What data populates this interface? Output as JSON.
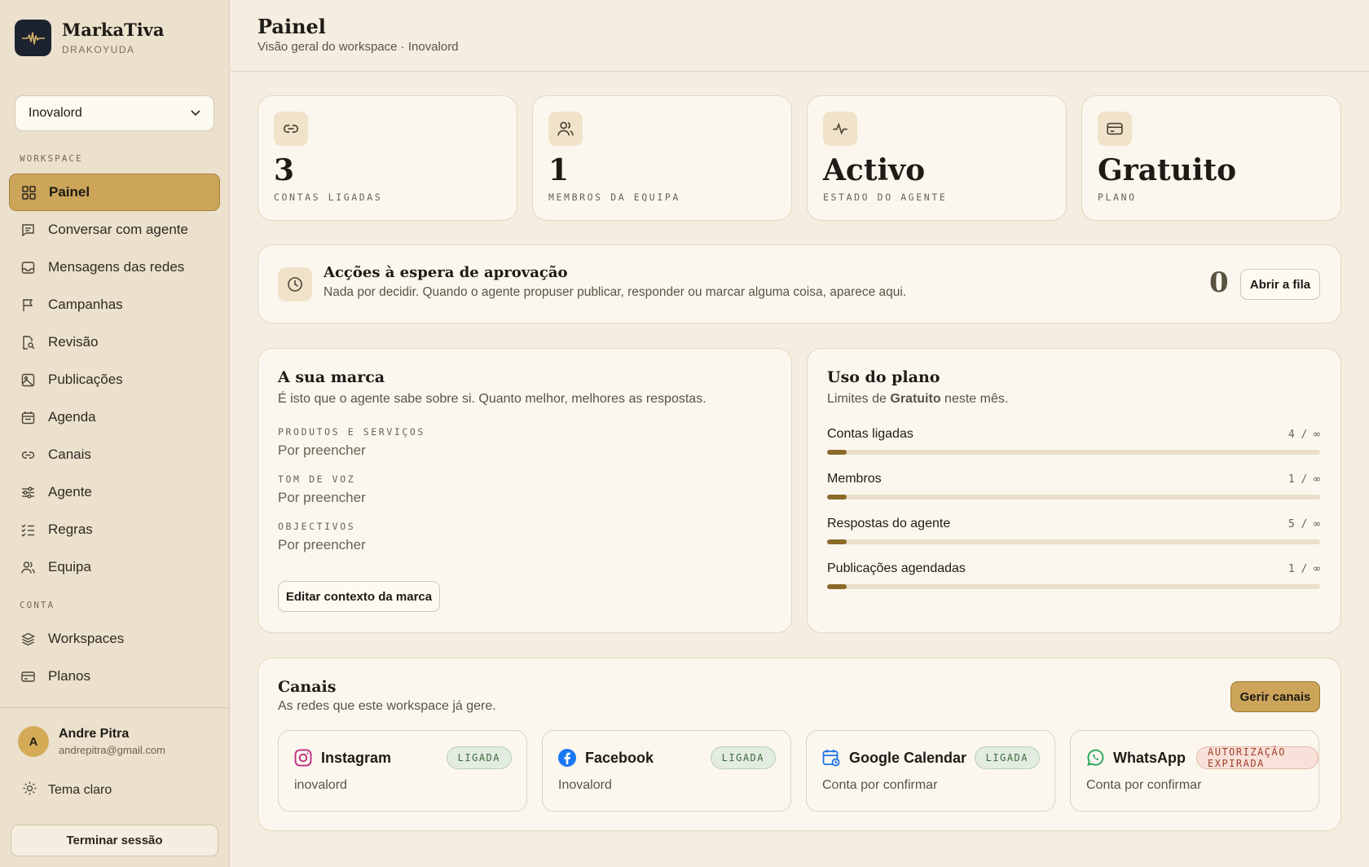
{
  "app": {
    "name": "MarkaTiva",
    "subtitle": "DRAKOYUDA"
  },
  "workspace_select": {
    "value": "Inovalord"
  },
  "sidebar": {
    "section_workspace": "WORKSPACE",
    "section_account": "CONTA",
    "items": [
      {
        "label": "Painel",
        "icon": "dashboard-icon",
        "active": true
      },
      {
        "label": "Conversar com agente",
        "icon": "chat-icon"
      },
      {
        "label": "Mensagens das redes",
        "icon": "inbox-icon"
      },
      {
        "label": "Campanhas",
        "icon": "flag-icon"
      },
      {
        "label": "Revisão",
        "icon": "review-icon"
      },
      {
        "label": "Publicações",
        "icon": "image-icon"
      },
      {
        "label": "Agenda",
        "icon": "calendar-icon"
      },
      {
        "label": "Canais",
        "icon": "link-icon"
      },
      {
        "label": "Agente",
        "icon": "sliders-icon"
      },
      {
        "label": "Regras",
        "icon": "list-check-icon"
      },
      {
        "label": "Equipa",
        "icon": "users-icon"
      }
    ],
    "account_items": [
      {
        "label": "Workspaces",
        "icon": "layers-icon"
      },
      {
        "label": "Planos",
        "icon": "credit-card-icon"
      }
    ],
    "user": {
      "initial": "A",
      "name": "Andre Pitra",
      "email": "andrepitra@gmail.com"
    },
    "theme_label": "Tema claro",
    "logout_label": "Terminar sessão"
  },
  "header": {
    "title": "Painel",
    "subtitle": "Visão geral do workspace · Inovalord"
  },
  "stats": [
    {
      "value": "3",
      "label": "CONTAS LIGADAS",
      "icon": "link-icon"
    },
    {
      "value": "1",
      "label": "MEMBROS DA EQUIPA",
      "icon": "users-icon"
    },
    {
      "value": "Activo",
      "label": "ESTADO DO AGENTE",
      "icon": "activity-icon"
    },
    {
      "value": "Gratuito",
      "label": "PLANO",
      "icon": "credit-card-icon"
    }
  ],
  "pending": {
    "title": "Acções à espera de aprovação",
    "description": "Nada por decidir. Quando o agente propuser publicar, responder ou marcar alguma coisa, aparece aqui.",
    "count": "0",
    "button": "Abrir a fila"
  },
  "brand": {
    "title": "A sua marca",
    "subtitle": "É isto que o agente sabe sobre si. Quanto melhor, melhores as respostas.",
    "fields": [
      {
        "label": "PRODUTOS E SERVIÇOS",
        "value": "Por preencher"
      },
      {
        "label": "TOM DE VOZ",
        "value": "Por preencher"
      },
      {
        "label": "OBJECTIVOS",
        "value": "Por preencher"
      }
    ],
    "button": "Editar contexto da marca"
  },
  "usage": {
    "title": "Uso do plano",
    "subtitle_prefix": "Limites de ",
    "subtitle_plan": "Gratuito",
    "subtitle_suffix": " neste mês.",
    "rows": [
      {
        "name": "Contas ligadas",
        "value": "4 / ∞",
        "fill": 0.04
      },
      {
        "name": "Membros",
        "value": "1 / ∞",
        "fill": 0.04
      },
      {
        "name": "Respostas do agente",
        "value": "5 / ∞",
        "fill": 0.04
      },
      {
        "name": "Publicações agendadas",
        "value": "1 / ∞",
        "fill": 0.04
      }
    ]
  },
  "channels": {
    "title": "Canais",
    "subtitle": "As redes que este workspace já gere.",
    "button": "Gerir canais",
    "items": [
      {
        "name": "Instagram",
        "account": "inovalord",
        "status": "LIGADA",
        "icon": "instagram-icon",
        "color": "#c13584"
      },
      {
        "name": "Facebook",
        "account": "Inovalord",
        "status": "LIGADA",
        "icon": "facebook-icon",
        "color": "#1877f2"
      },
      {
        "name": "Google Calendar",
        "account": "Conta por confirmar",
        "status": "LIGADA",
        "icon": "google-calendar-icon",
        "color": "#1a73e8"
      },
      {
        "name": "WhatsApp",
        "account": "Conta por confirmar",
        "status": "AUTORIZAÇÃO EXPIRADA",
        "icon": "whatsapp-icon",
        "color": "#25d366"
      }
    ]
  },
  "colors": {
    "accent": "#cca45a",
    "background": "#f4ede0",
    "card": "#fbf7ef",
    "bar": "#8a6a28"
  }
}
